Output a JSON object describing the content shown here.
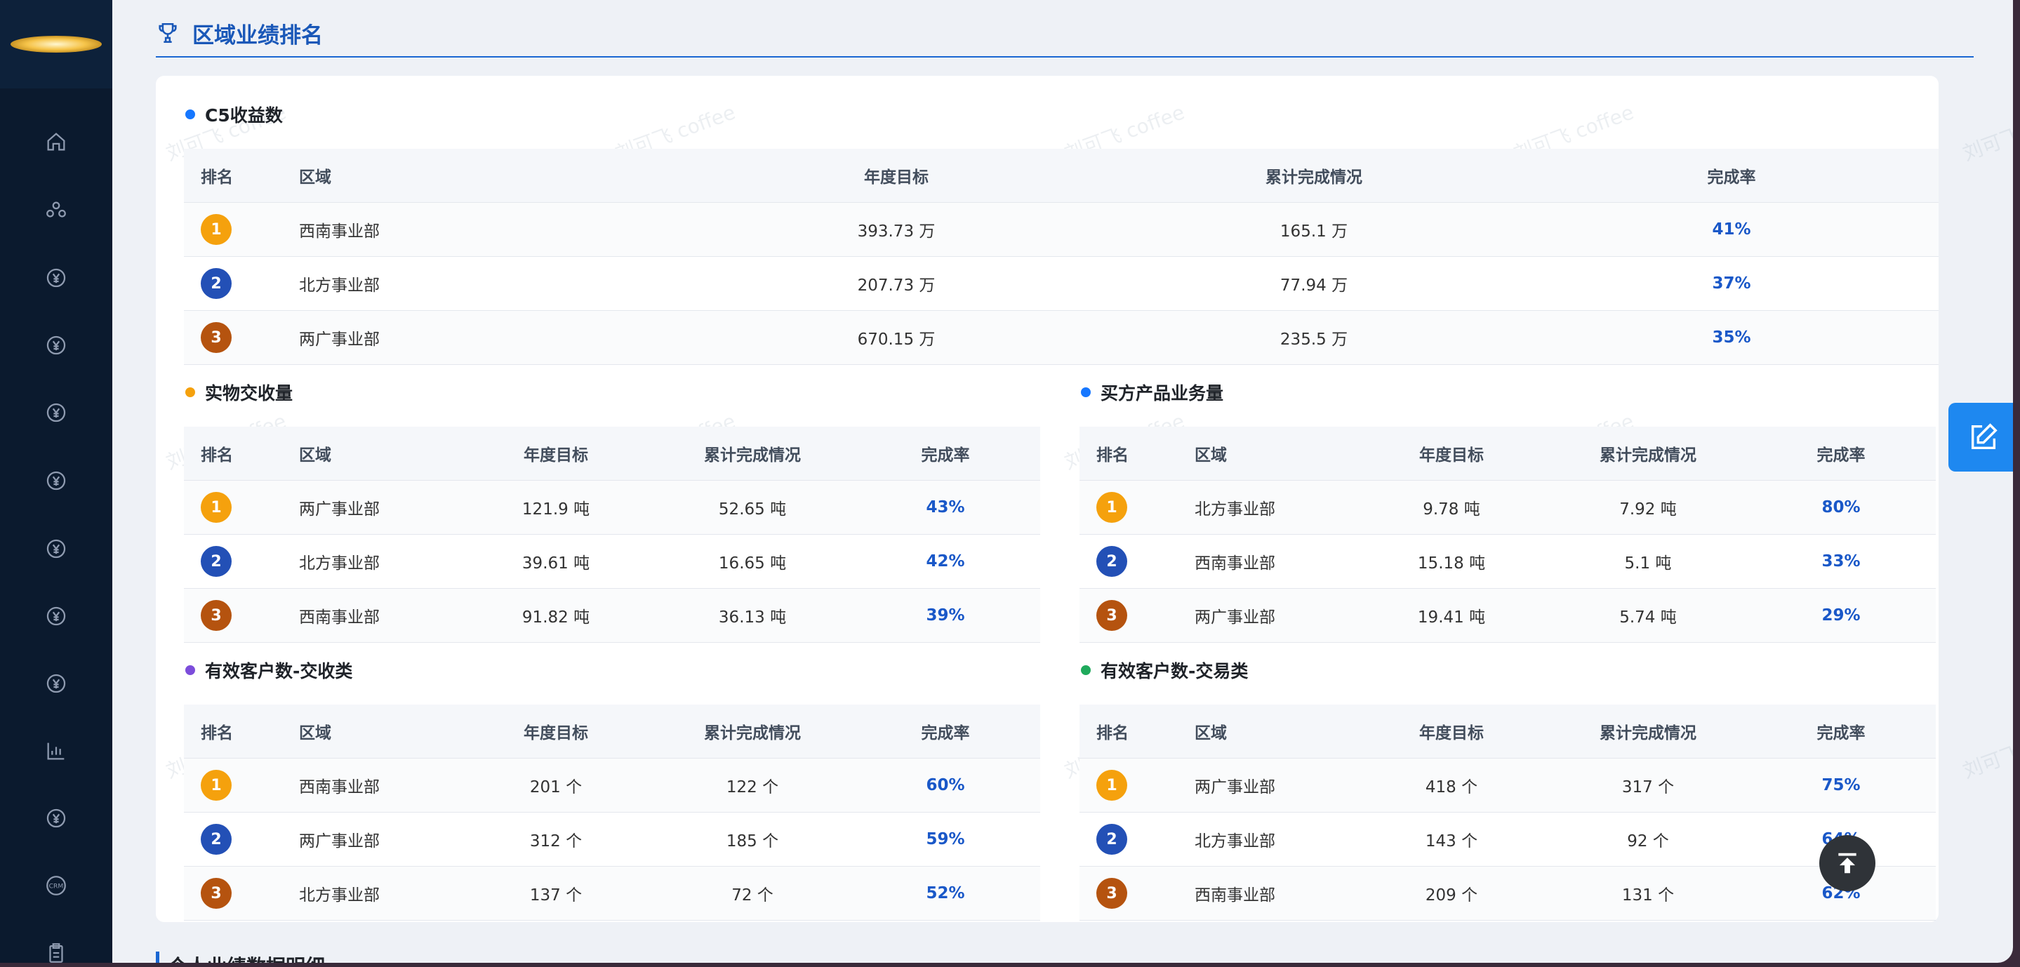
{
  "section": {
    "title": "区域业绩排名",
    "icon": "trophy-icon"
  },
  "sidebar": {
    "icons": [
      "home-icon",
      "user-group-icon",
      "yen-circle-icon",
      "yen-circle-icon",
      "yen-circle-icon",
      "yen-circle-icon",
      "yen-circle-icon",
      "yen-circle-icon",
      "yen-circle-icon",
      "chart-icon",
      "yen-circle-icon",
      "crm-icon",
      "clipboard-icon"
    ],
    "crm_label": "CRM"
  },
  "watermark": "刘可飞 coffee",
  "columns": [
    "排名",
    "区域",
    "年度目标",
    "累计完成情况",
    "完成率"
  ],
  "tables": {
    "c5": {
      "title": "C5收益数",
      "dot_color": "#1677ff",
      "rows": [
        {
          "rank": "1",
          "region": "西南事业部",
          "target": "393.73 万",
          "done": "165.1 万",
          "rate": "41%"
        },
        {
          "rank": "2",
          "region": "北方事业部",
          "target": "207.73 万",
          "done": "77.94 万",
          "rate": "37%"
        },
        {
          "rank": "3",
          "region": "两广事业部",
          "target": "670.15 万",
          "done": "235.5 万",
          "rate": "35%"
        }
      ]
    },
    "physical": {
      "title": "实物交收量",
      "dot_color": "#f5a10d",
      "rows": [
        {
          "rank": "1",
          "region": "两广事业部",
          "target": "121.9 吨",
          "done": "52.65 吨",
          "rate": "43%"
        },
        {
          "rank": "2",
          "region": "北方事业部",
          "target": "39.61 吨",
          "done": "16.65 吨",
          "rate": "42%"
        },
        {
          "rank": "3",
          "region": "西南事业部",
          "target": "91.82 吨",
          "done": "36.13 吨",
          "rate": "39%"
        }
      ]
    },
    "buyer": {
      "title": "买方产品业务量",
      "dot_color": "#1677ff",
      "rows": [
        {
          "rank": "1",
          "region": "北方事业部",
          "target": "9.78 吨",
          "done": "7.92 吨",
          "rate": "80%"
        },
        {
          "rank": "2",
          "region": "西南事业部",
          "target": "15.18 吨",
          "done": "5.1 吨",
          "rate": "33%"
        },
        {
          "rank": "3",
          "region": "两广事业部",
          "target": "19.41 吨",
          "done": "5.74 吨",
          "rate": "29%"
        }
      ]
    },
    "cust_delivery": {
      "title": "有效客户数-交收类",
      "dot_color": "#7c4ddb",
      "rows": [
        {
          "rank": "1",
          "region": "西南事业部",
          "target": "201 个",
          "done": "122 个",
          "rate": "60%"
        },
        {
          "rank": "2",
          "region": "两广事业部",
          "target": "312 个",
          "done": "185 个",
          "rate": "59%"
        },
        {
          "rank": "3",
          "region": "北方事业部",
          "target": "137 个",
          "done": "72 个",
          "rate": "52%"
        }
      ]
    },
    "cust_trade": {
      "title": "有效客户数-交易类",
      "dot_color": "#1faa5c",
      "rows": [
        {
          "rank": "1",
          "region": "两广事业部",
          "target": "418 个",
          "done": "317 个",
          "rate": "75%"
        },
        {
          "rank": "2",
          "region": "北方事业部",
          "target": "143 个",
          "done": "92 个",
          "rate": "64%"
        },
        {
          "rank": "3",
          "region": "西南事业部",
          "target": "209 个",
          "done": "131 个",
          "rate": "62%"
        }
      ]
    }
  },
  "bottom_title": "个人业绩数据明细",
  "floating": {
    "edit_icon": "edit-icon",
    "top_icon": "back-to-top-icon"
  }
}
